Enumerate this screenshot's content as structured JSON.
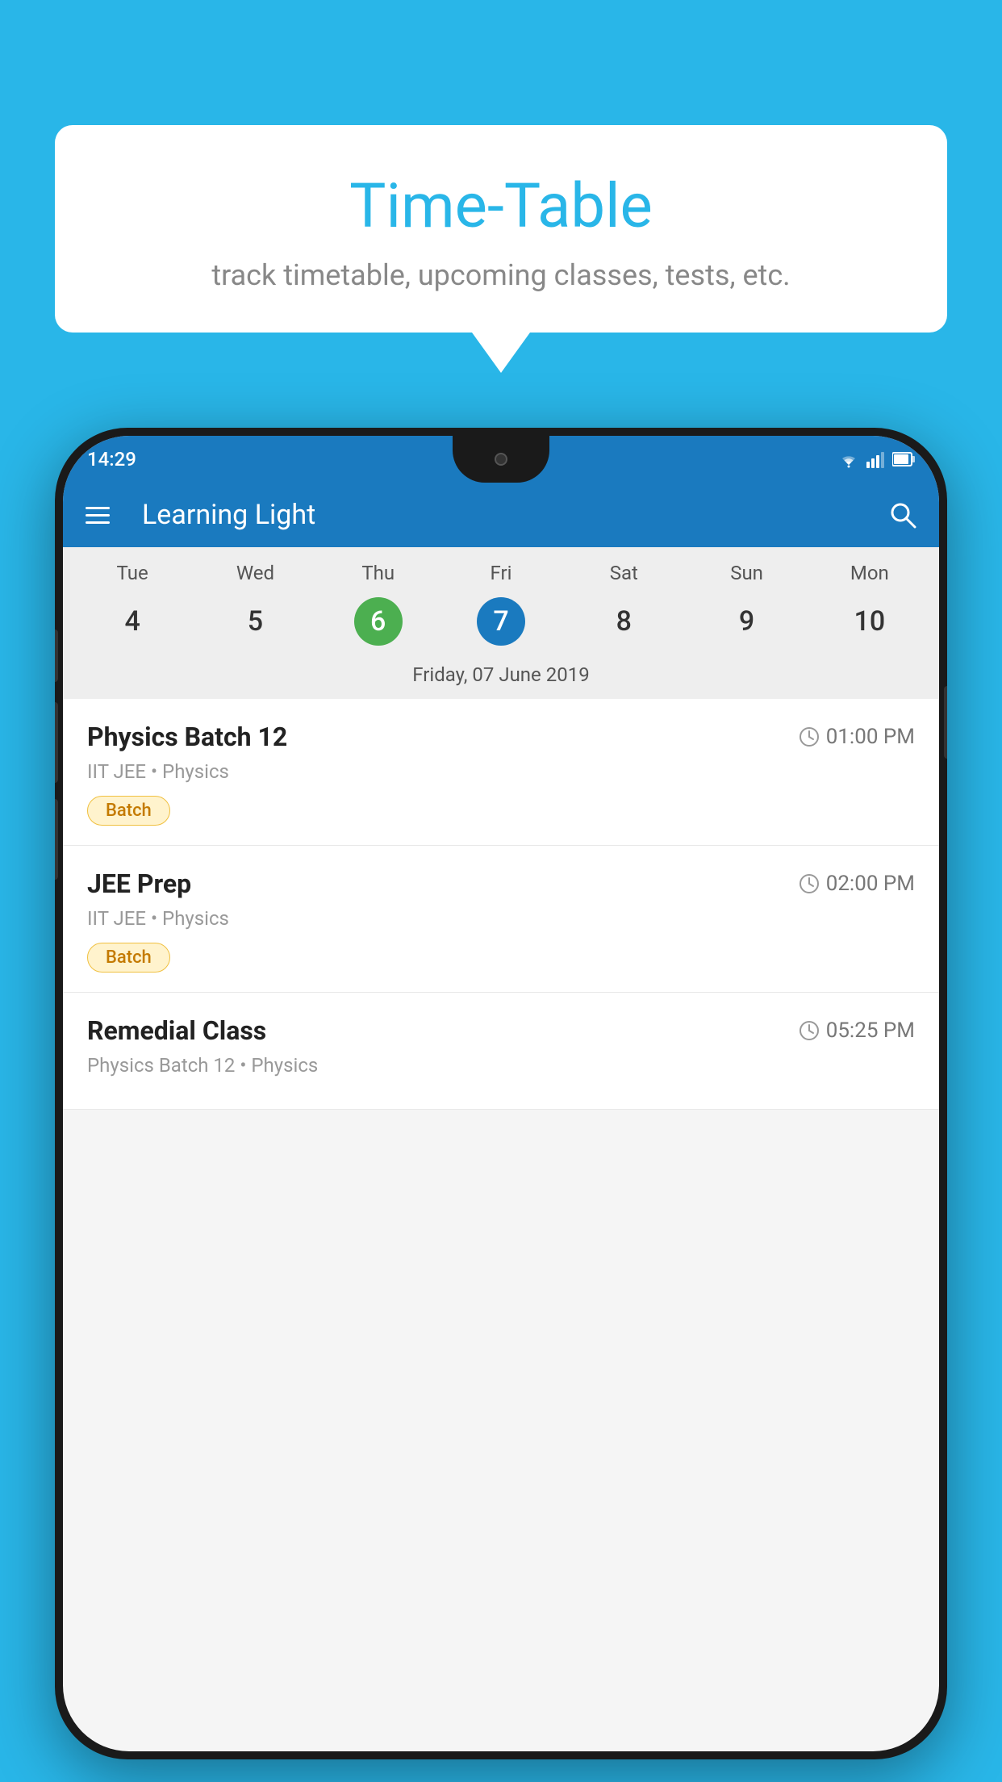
{
  "background_color": "#29b6e8",
  "speech_bubble": {
    "title": "Time-Table",
    "subtitle": "track timetable, upcoming classes, tests, etc."
  },
  "phone": {
    "status_bar": {
      "time": "14:29",
      "icons": [
        "wifi",
        "signal",
        "battery"
      ]
    },
    "app_bar": {
      "title": "Learning Light"
    },
    "calendar": {
      "days": [
        "Tue",
        "Wed",
        "Thu",
        "Fri",
        "Sat",
        "Sun",
        "Mon"
      ],
      "dates": [
        "4",
        "5",
        "6",
        "7",
        "8",
        "9",
        "10"
      ],
      "today_index": 2,
      "selected_index": 3,
      "selected_date_label": "Friday, 07 June 2019"
    },
    "classes": [
      {
        "name": "Physics Batch 12",
        "time": "01:00 PM",
        "meta": "IIT JEE • Physics",
        "badge": "Batch"
      },
      {
        "name": "JEE Prep",
        "time": "02:00 PM",
        "meta": "IIT JEE • Physics",
        "badge": "Batch"
      },
      {
        "name": "Remedial Class",
        "time": "05:25 PM",
        "meta": "Physics Batch 12 • Physics",
        "badge": ""
      }
    ]
  }
}
